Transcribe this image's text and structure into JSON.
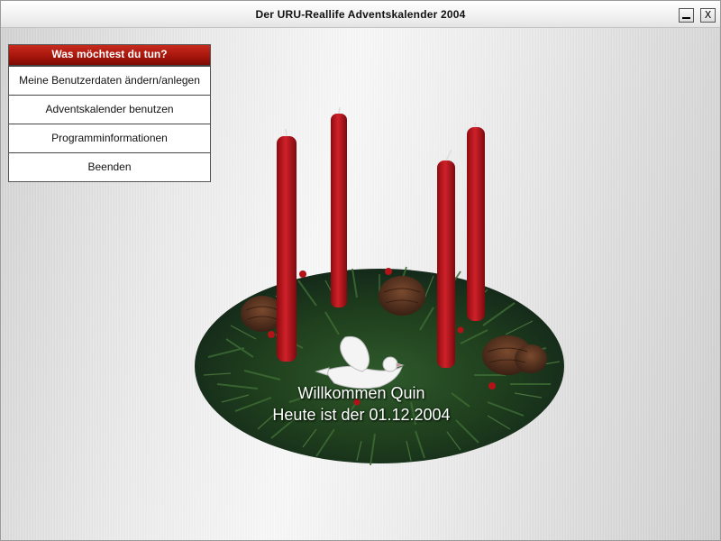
{
  "window": {
    "title": "Der URU-Reallife Adventskalender 2004",
    "minimize_label": "_",
    "close_label": "X"
  },
  "menu": {
    "header": "Was möchtest du tun?",
    "items": [
      {
        "label": "Meine Benutzerdaten ändern/anlegen"
      },
      {
        "label": "Adventskalender benutzen"
      },
      {
        "label": "Programminformationen"
      },
      {
        "label": "Beenden"
      }
    ]
  },
  "greeting": {
    "line1": "Willkommen Quin",
    "line2": "Heute ist der 01.12.2004"
  },
  "colors": {
    "menu_header_red": "#a8160c",
    "candle_red": "#c2151b",
    "greenery": "#1f3a1e"
  },
  "icons": [
    "minimize-icon",
    "close-icon",
    "advent-wreath-image"
  ]
}
